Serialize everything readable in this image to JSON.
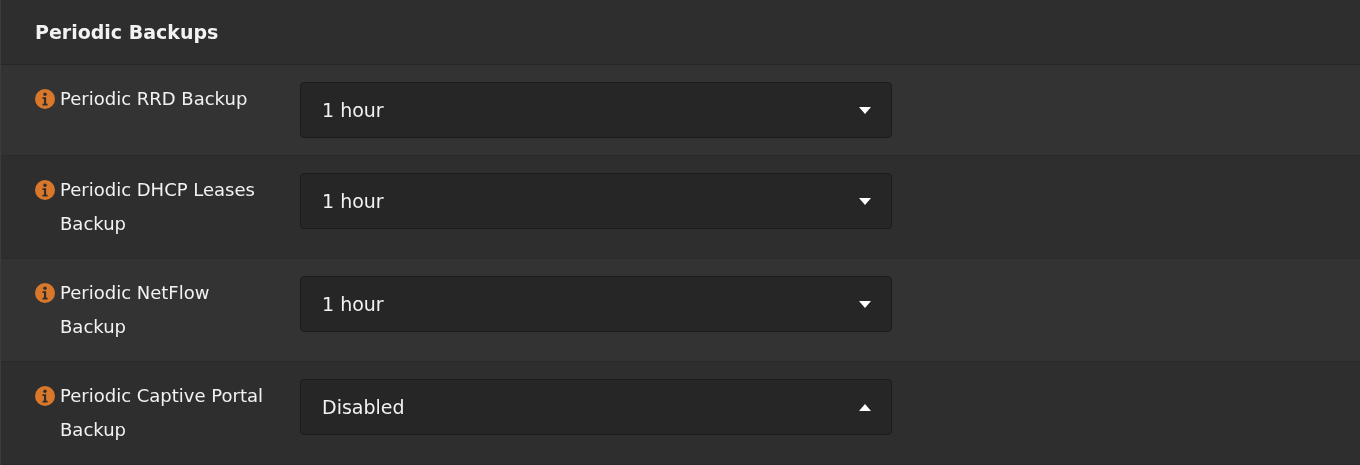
{
  "section": {
    "title": "Periodic Backups"
  },
  "settings": [
    {
      "label": "Periodic RRD Backup",
      "value": "1 hour",
      "expanded": false
    },
    {
      "label": "Periodic DHCP Leases Backup",
      "value": "1 hour",
      "expanded": false
    },
    {
      "label": "Periodic NetFlow Backup",
      "value": "1 hour",
      "expanded": false
    },
    {
      "label": "Periodic Captive Portal Backup",
      "value": "Disabled",
      "expanded": true
    }
  ]
}
